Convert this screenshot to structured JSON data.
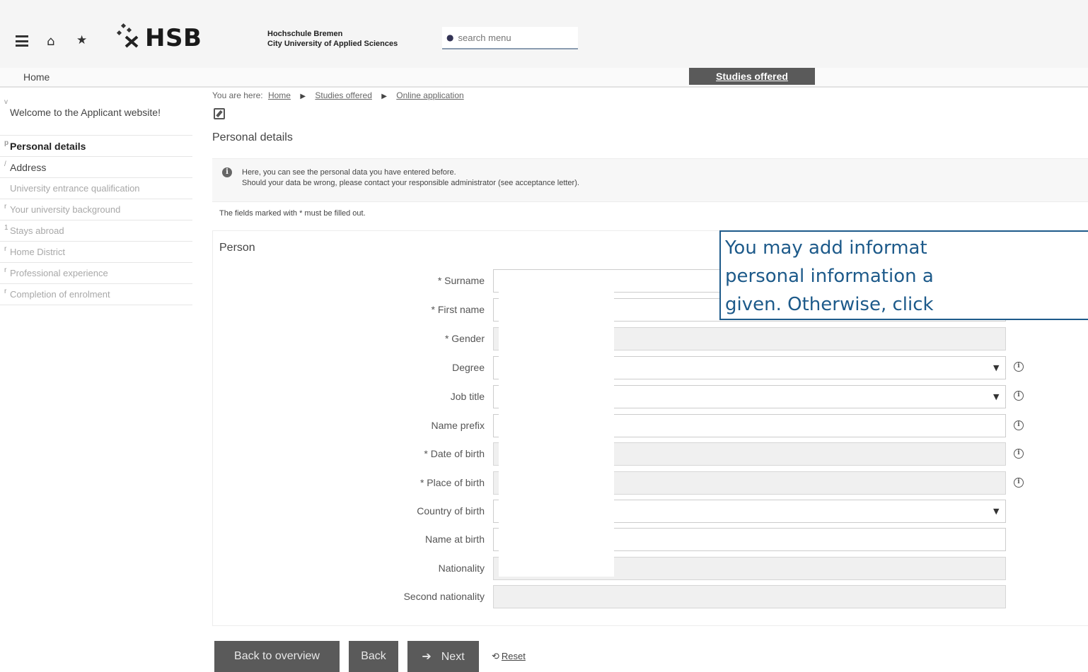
{
  "header": {
    "brand_logo": "HSB",
    "university_line1": "Hochschule Bremen",
    "university_line2": "City University of Applied Sciences",
    "search_placeholder": "search menu"
  },
  "navbar": {
    "home_label": "Home",
    "studies_label": "Studies offered"
  },
  "sidebar": {
    "items": [
      {
        "label": "Welcome to the Applicant website!",
        "state": "enabled"
      },
      {
        "label": "Personal details",
        "state": "active"
      },
      {
        "label": "Address",
        "state": "enabled"
      },
      {
        "label": "University entrance qualification",
        "state": "disabled"
      },
      {
        "label": "Your university background",
        "state": "disabled"
      },
      {
        "label": "Stays abroad",
        "state": "disabled"
      },
      {
        "label": "Home District",
        "state": "disabled"
      },
      {
        "label": "Professional experience",
        "state": "disabled"
      },
      {
        "label": "Completion of enrolment",
        "state": "disabled"
      }
    ]
  },
  "breadcrumb": {
    "prefix": "You are here:",
    "items": [
      "Home",
      "Studies offered",
      "Online application"
    ]
  },
  "page_title": "Personal details",
  "info": {
    "line1": "Here, you can see the personal data you have entered before.",
    "line2": "Should your data be wrong, please contact your responsible administrator (see acceptance letter)."
  },
  "required_note": "The fields marked with * must be filled out.",
  "person": {
    "title": "Person",
    "fields": [
      {
        "label": "* Surname",
        "type": "text",
        "readonly": false
      },
      {
        "label": "* First name",
        "type": "text",
        "readonly": false
      },
      {
        "label": "* Gender",
        "type": "text",
        "readonly": true
      },
      {
        "label": "Degree",
        "type": "select",
        "readonly": false,
        "info": true
      },
      {
        "label": "Job title",
        "type": "select",
        "readonly": false,
        "info": true
      },
      {
        "label": "Name prefix",
        "type": "text",
        "readonly": false,
        "info": true
      },
      {
        "label": "* Date of birth",
        "type": "text",
        "readonly": true,
        "info": true
      },
      {
        "label": "* Place of birth",
        "type": "text",
        "readonly": true,
        "info": true
      },
      {
        "label": "Country of birth",
        "type": "select",
        "readonly": false
      },
      {
        "label": "Name at birth",
        "type": "text",
        "readonly": false
      },
      {
        "label": "Nationality",
        "type": "text",
        "readonly": true
      },
      {
        "label": "Second nationality",
        "type": "text",
        "readonly": true
      }
    ]
  },
  "callout": {
    "line1": "You may add informat",
    "line2": "personal information a",
    "line3": "given. Otherwise, click"
  },
  "buttons": {
    "overview": "Back to overview",
    "back": "Back",
    "next": "Next",
    "reset": "Reset"
  },
  "colors": {
    "button_bg": "#5a5a5a",
    "callout_border": "#1d5a8a"
  }
}
